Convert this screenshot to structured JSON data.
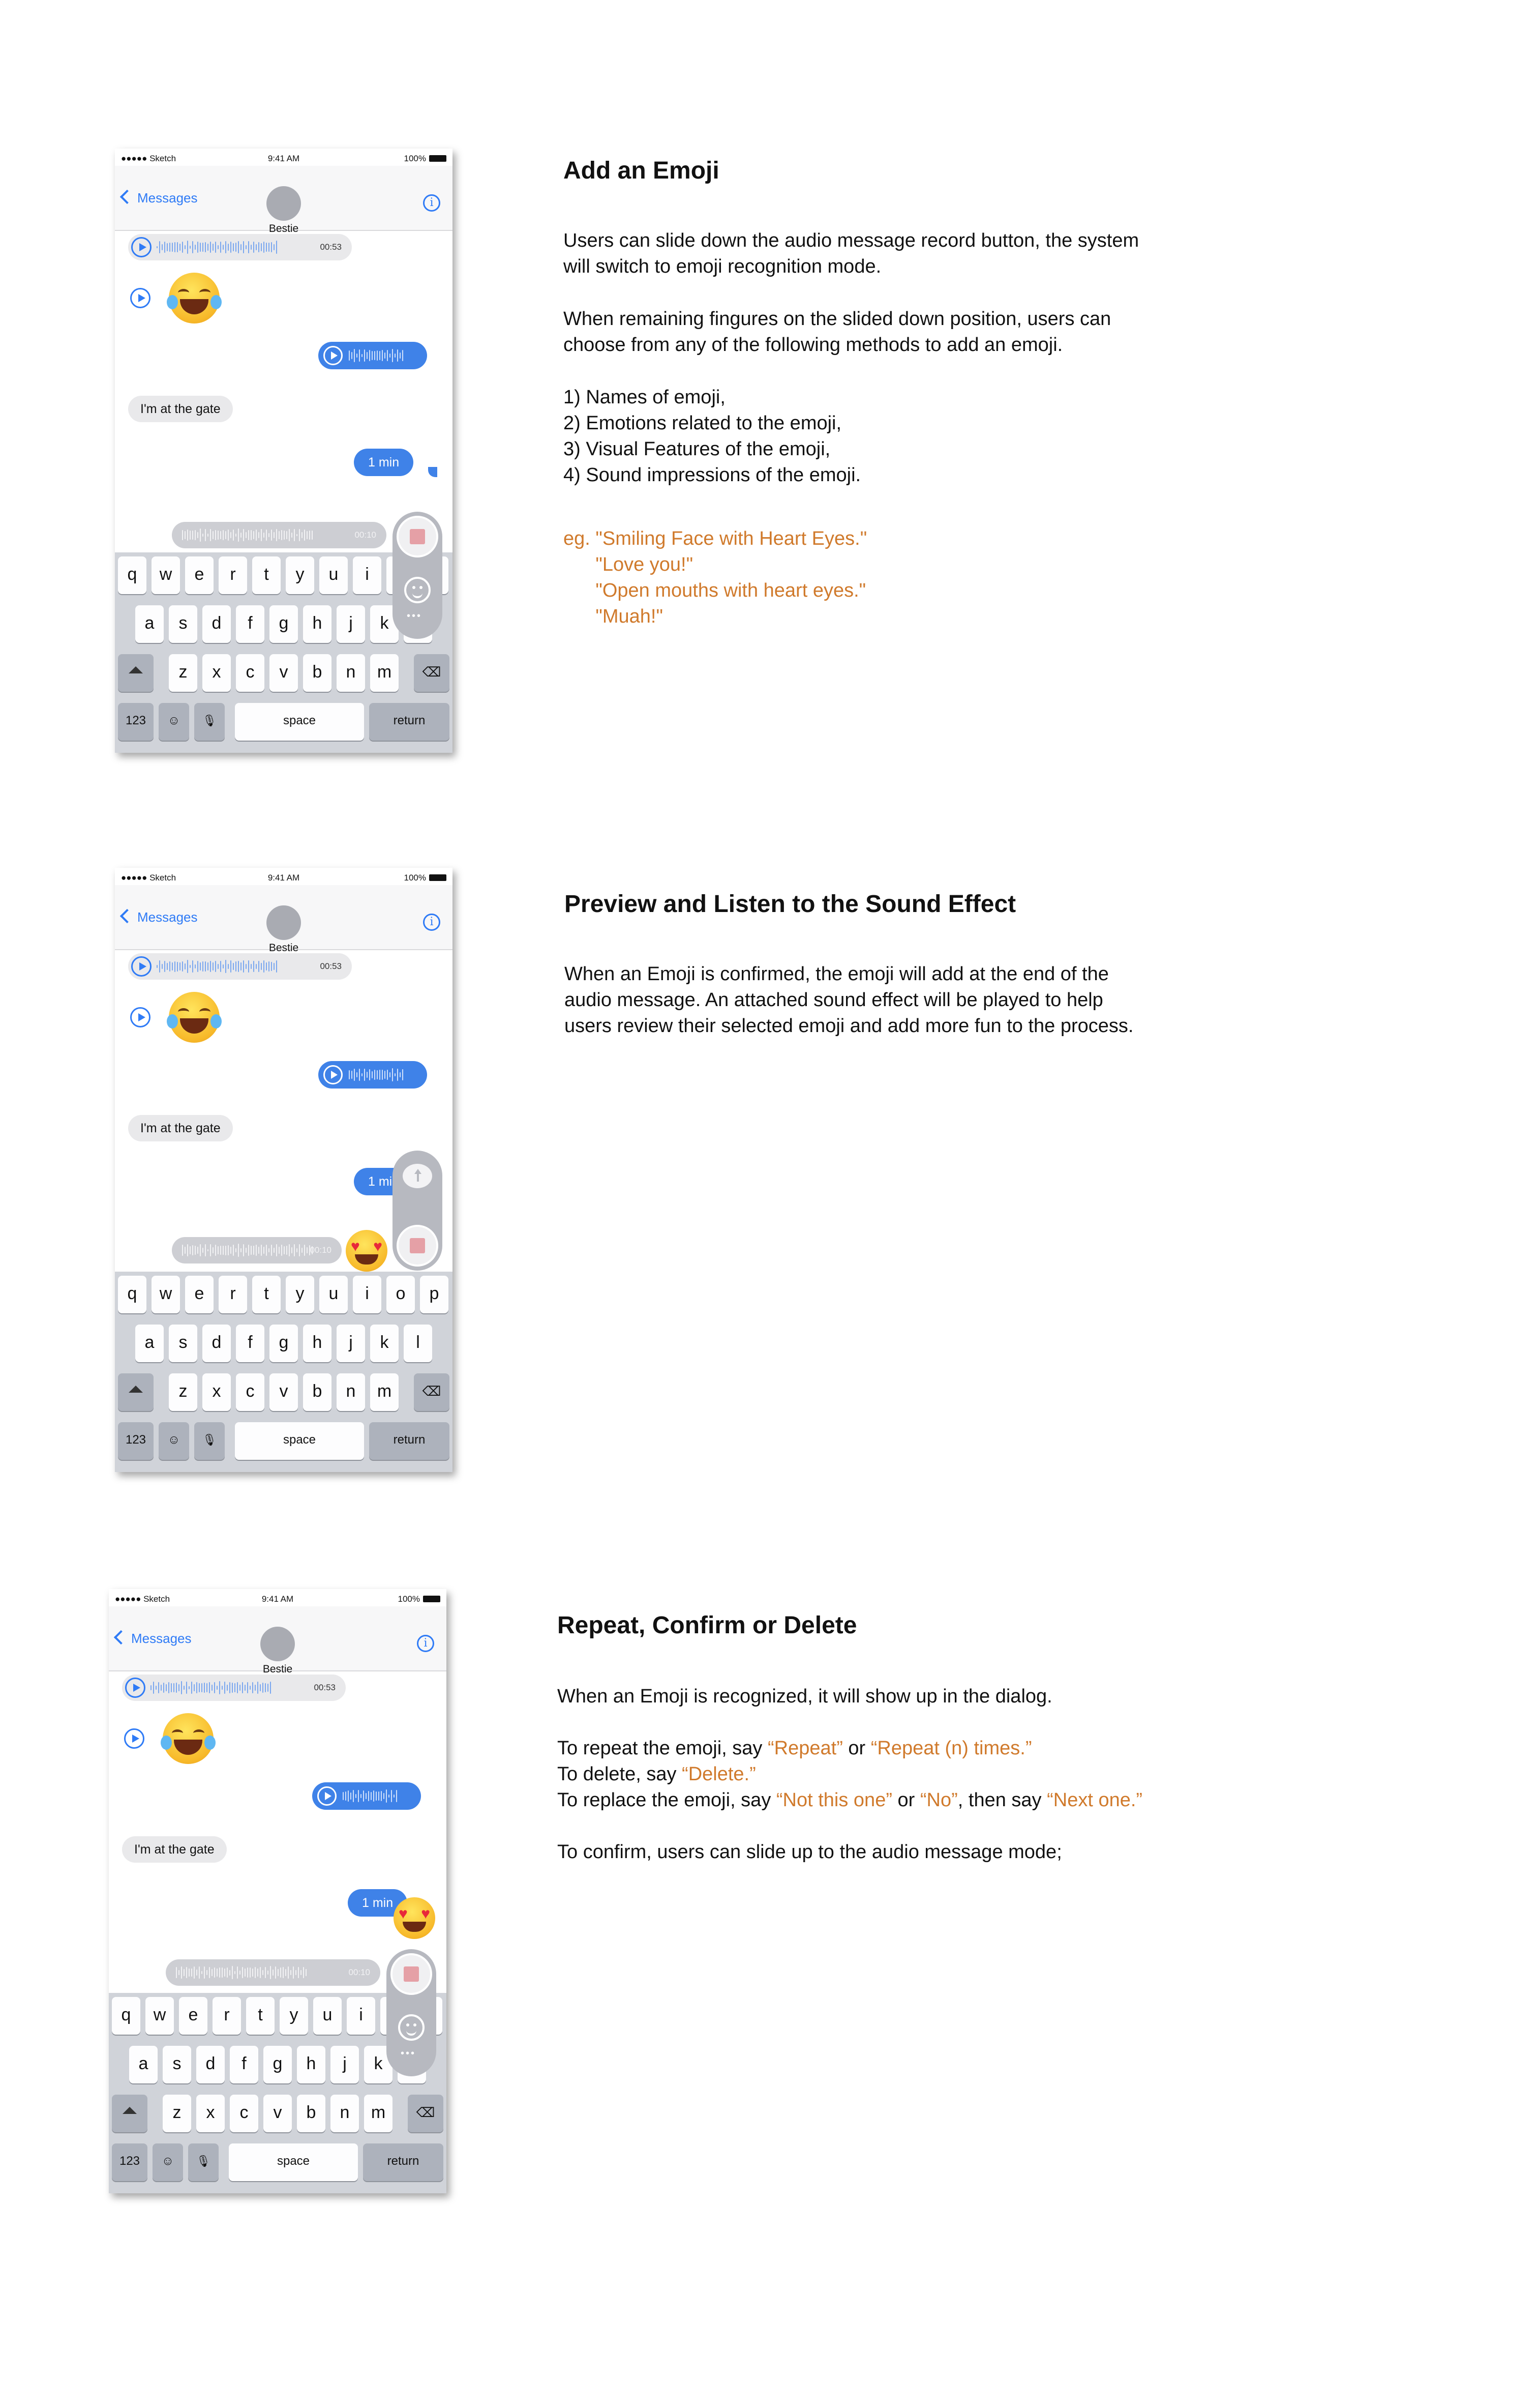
{
  "phone": {
    "carrier": "●●●●● Sketch",
    "time": "9:41 AM",
    "battery": "100%",
    "back_label": "Messages",
    "contact": "Bestie",
    "info_glyph": "i",
    "audio_left_duration": "00:53",
    "text_left": "I'm at the gate",
    "text_right": "1 min",
    "recording_duration": "00:10",
    "keys_row1": [
      "q",
      "w",
      "e",
      "r",
      "t",
      "y",
      "u",
      "i",
      "o",
      "p"
    ],
    "keys_row2": [
      "a",
      "s",
      "d",
      "f",
      "g",
      "h",
      "j",
      "k",
      "l"
    ],
    "keys_row3": [
      "z",
      "x",
      "c",
      "v",
      "b",
      "n",
      "m"
    ],
    "key_123": "123",
    "key_emoji": "☺",
    "key_mic": "🎙",
    "key_space": "space",
    "key_return": "return",
    "key_shift": "shift",
    "key_delete": "⌫"
  },
  "sections": [
    {
      "title": "Add an Emoji",
      "p1": "Users can slide down the audio message record button, the system\nwill switch to emoji recognition mode.",
      "p2": "When remaining fingures on the slided down position, users can\nchoose from any of the following methods to add an emoji.",
      "list": [
        "1) Names of emoji,",
        "2) Emotions related to the emoji,",
        "3) Visual Features of the emoji,",
        "4) Sound impressions of the emoji."
      ],
      "eg": [
        "eg. \"Smiling Face with Heart Eyes.\"",
        "      \"Love you!\"",
        "      \"Open mouths with heart eyes.\"",
        "      \"Muah!\""
      ]
    },
    {
      "title": "Preview and Listen to the Sound Effect",
      "p1": "When an Emoji is confirmed, the emoji will add at the end of the\naudio message. An attached sound effect will be played to help\nusers review their selected emoji and add more fun to the process."
    },
    {
      "title": "Repeat, Confirm or Delete",
      "line1": "When an Emoji is recognized, it will show up in the dialog.",
      "repeat_pre": "To repeat the emoji, say ",
      "repeat_q1": "“Repeat”",
      "repeat_or": " or ",
      "repeat_q2": "“Repeat (n) times.”",
      "delete_pre": "To delete, say ",
      "delete_q": "“Delete.”",
      "replace_pre": "To replace the emoji, say ",
      "replace_q1": "“Not this one”",
      "replace_or": " or ",
      "replace_q2": "“No”",
      "replace_mid": ", then say ",
      "replace_q3": "“Next one.”",
      "confirm": "To confirm, users can slide up to the audio message mode;"
    }
  ],
  "colors": {
    "accent_blue": "#2f7bf6",
    "bubble_blue": "#3f82e8",
    "orange_text": "#d07a2c"
  }
}
